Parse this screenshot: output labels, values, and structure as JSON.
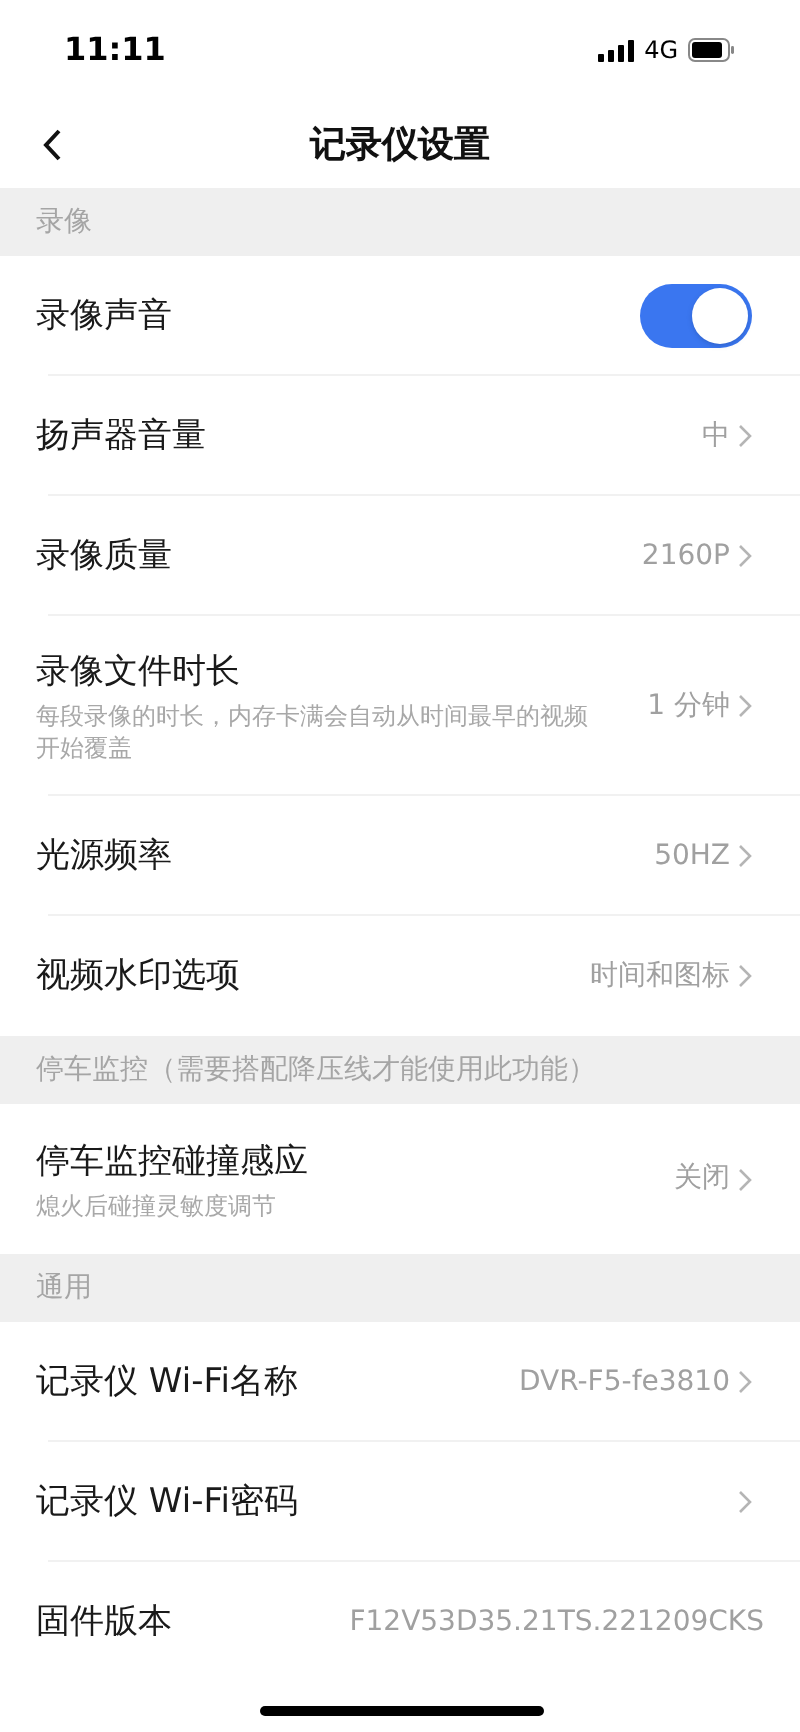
{
  "status_bar": {
    "time": "11:11",
    "network": "4G"
  },
  "nav": {
    "title": "记录仪设置"
  },
  "sections": [
    {
      "header": "录像",
      "items": [
        {
          "kind": "toggle",
          "label": "录像声音",
          "on": true
        },
        {
          "kind": "link",
          "label": "扬声器音量",
          "value": "中"
        },
        {
          "kind": "link",
          "label": "录像质量",
          "value": "2160P"
        },
        {
          "kind": "link",
          "label": "录像文件时长",
          "subtitle": "每段录像的时长，内存卡满会自动从时间最早的视频开始覆盖",
          "value": "1 分钟"
        },
        {
          "kind": "link",
          "label": "光源频率",
          "value": "50HZ"
        },
        {
          "kind": "link",
          "label": "视频水印选项",
          "value": "时间和图标"
        }
      ]
    },
    {
      "header": "停车监控（需要搭配降压线才能使用此功能）",
      "items": [
        {
          "kind": "link",
          "label": "停车监控碰撞感应",
          "subtitle": "熄火后碰撞灵敏度调节",
          "value": "关闭"
        }
      ]
    },
    {
      "header": "通用",
      "items": [
        {
          "kind": "link",
          "label": "记录仪 Wi-Fi名称",
          "value": "DVR-F5-fe3810"
        },
        {
          "kind": "link",
          "label": "记录仪 Wi-Fi密码"
        },
        {
          "kind": "info",
          "label": "固件版本",
          "value": "F12V53D35.21TS.221209CKS"
        }
      ]
    }
  ]
}
